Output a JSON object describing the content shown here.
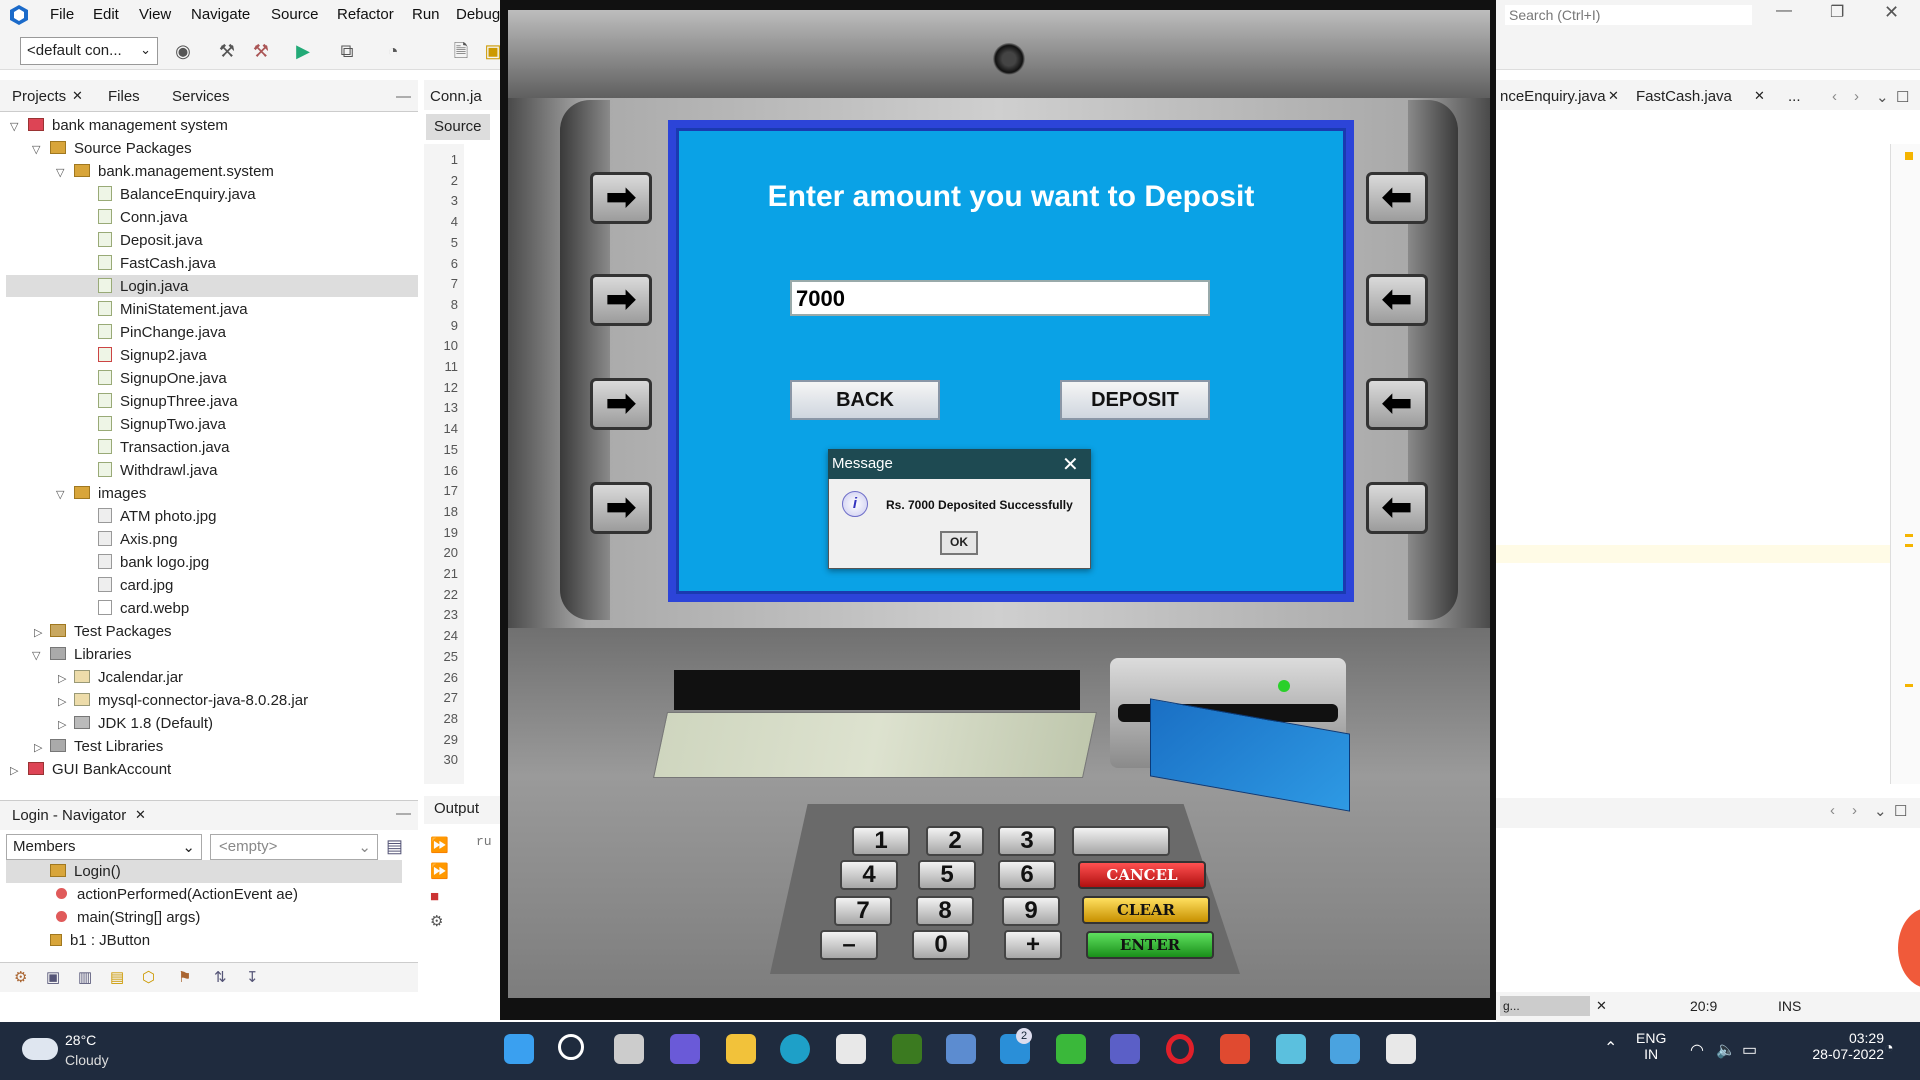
{
  "menu": [
    "File",
    "Edit",
    "View",
    "Navigate",
    "Source",
    "Refactor",
    "Run",
    "Debug"
  ],
  "toolbar": {
    "config": "<default con..."
  },
  "search_placeholder": "Search (Ctrl+I)",
  "left_tabs": [
    "Projects",
    "Files",
    "Services"
  ],
  "tree": [
    {
      "label": "bank management system"
    },
    {
      "label": "Source Packages"
    },
    {
      "label": "bank.management.system"
    },
    {
      "label": "BalanceEnquiry.java"
    },
    {
      "label": "Conn.java"
    },
    {
      "label": "Deposit.java"
    },
    {
      "label": "FastCash.java"
    },
    {
      "label": "Login.java"
    },
    {
      "label": "MiniStatement.java"
    },
    {
      "label": "PinChange.java"
    },
    {
      "label": "Signup2.java"
    },
    {
      "label": "SignupOne.java"
    },
    {
      "label": "SignupThree.java"
    },
    {
      "label": "SignupTwo.java"
    },
    {
      "label": "Transaction.java"
    },
    {
      "label": "Withdrawl.java"
    },
    {
      "label": "images"
    },
    {
      "label": "ATM photo.jpg"
    },
    {
      "label": "Axis.png"
    },
    {
      "label": "bank logo.jpg"
    },
    {
      "label": "card.jpg"
    },
    {
      "label": "card.webp"
    },
    {
      "label": "Test Packages"
    },
    {
      "label": "Libraries"
    },
    {
      "label": "Jcalendar.jar"
    },
    {
      "label": "mysql-connector-java-8.0.28.jar"
    },
    {
      "label": "JDK 1.8 (Default)"
    },
    {
      "label": "Test Libraries"
    },
    {
      "label": "GUI BankAccount"
    }
  ],
  "navigator": {
    "title": "Login - Navigator",
    "members": "Members",
    "empty": "<empty>",
    "items": [
      "Login()",
      "actionPerformed(ActionEvent ae)",
      "main(String[] args)",
      "b1 : JButton"
    ]
  },
  "editor": {
    "tab": "Conn.ja",
    "source_tab": "Source",
    "line_numbers": [
      "1",
      "2",
      "3",
      "4",
      "5",
      "6",
      "7",
      "8",
      "9",
      "10",
      "11",
      "12",
      "13",
      "14",
      "15",
      "16",
      "17",
      "18",
      "19",
      "20",
      "21",
      "22",
      "23",
      "24",
      "25",
      "26",
      "27",
      "28",
      "29",
      "30"
    ],
    "output_tab": "Output",
    "output_text": "ru"
  },
  "right_tabs": [
    "nceEnquiry.java",
    "FastCash.java",
    "..."
  ],
  "statusbar": {
    "pos": "20:9",
    "mode": "INS",
    "progress": "g..."
  },
  "atm": {
    "title": "Enter amount you want to Deposit",
    "amount": "7000",
    "back": "BACK",
    "deposit": "DEPOSIT",
    "keys": [
      "1",
      "2",
      "3",
      "4",
      "5",
      "6",
      "7",
      "8",
      "9",
      "–",
      "0",
      "+"
    ],
    "cancel": "CANCEL",
    "clear": "CLEAR",
    "enter": "ENTER"
  },
  "dialog": {
    "title": "Message",
    "message": "Rs. 7000 Deposited Successfully",
    "ok": "OK"
  },
  "taskbar": {
    "temp": "28°C",
    "weather": "Cloudy",
    "lang1": "ENG",
    "lang2": "IN",
    "time": "03:29",
    "date": "28-07-2022",
    "badge": "2"
  },
  "colors": {
    "atm_screen": "#0aa2e6",
    "dialog_header": "#1e4a52",
    "taskbar": "#1f2b3e"
  }
}
